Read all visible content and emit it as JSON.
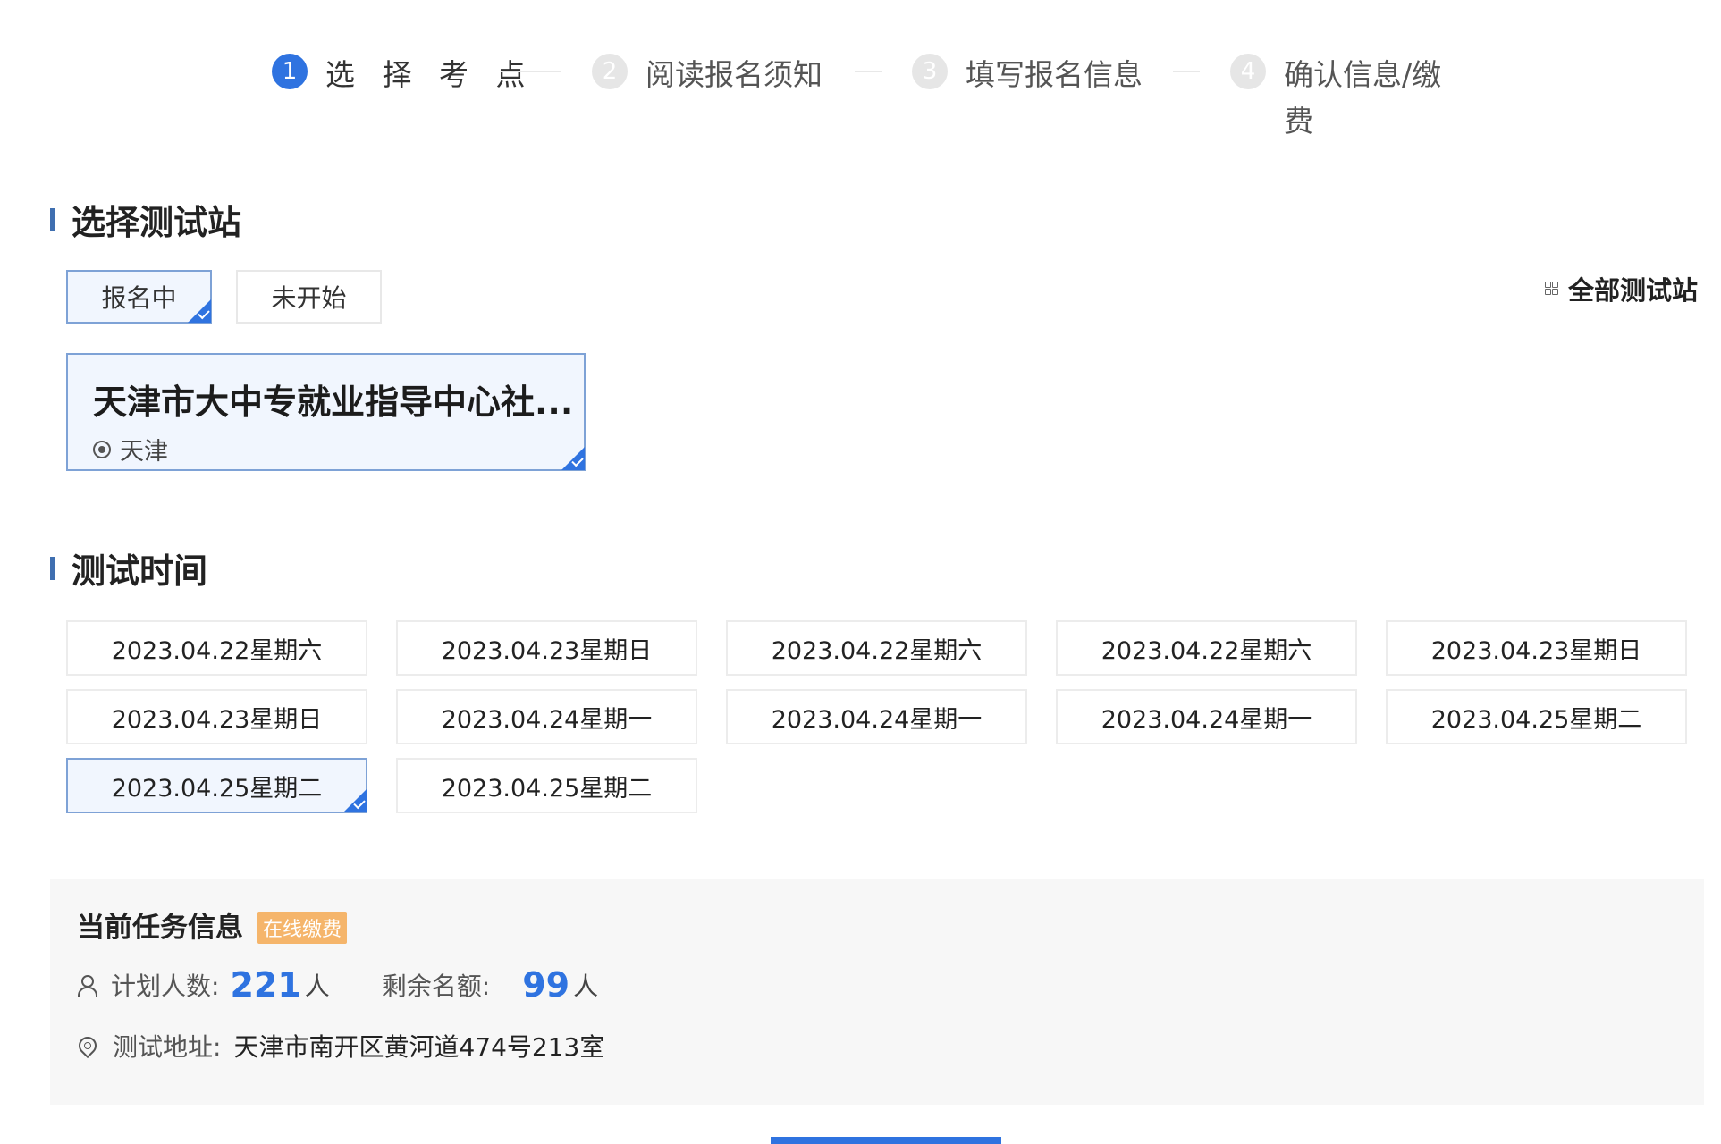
{
  "stepper": {
    "steps": [
      {
        "num": "1",
        "label": "选 择 考 点"
      },
      {
        "num": "2",
        "label": "阅读报名须知"
      },
      {
        "num": "3",
        "label": "填写报名信息"
      },
      {
        "num": "4",
        "label_line1": "确认信息/缴",
        "label_line2": "费"
      }
    ],
    "active_index": 0,
    "accent_color": "#2f73e0"
  },
  "station_section": {
    "title": "选择测试站",
    "tabs": [
      {
        "label": "报名中",
        "selected": true
      },
      {
        "label": "未开始",
        "selected": false
      }
    ],
    "all_stations_label": "全部测试站",
    "station": {
      "name": "天津市大中专就业指导中心社...",
      "location": "天津",
      "selected": true
    }
  },
  "time_section": {
    "title": "测试时间",
    "dates": [
      "2023.04.22星期六",
      "2023.04.23星期日",
      "2023.04.22星期六",
      "2023.04.22星期六",
      "2023.04.23星期日",
      "2023.04.23星期日",
      "2023.04.24星期一",
      "2023.04.24星期一",
      "2023.04.24星期一",
      "2023.04.25星期二",
      "2023.04.25星期二",
      "2023.04.25星期二"
    ],
    "selected_index": 10
  },
  "task_info": {
    "title": "当前任务信息",
    "badge": "在线缴费",
    "planned_label": "计划人数:",
    "planned_value": "221",
    "planned_unit": "人",
    "remaining_label": "剩余名额:",
    "remaining_value": "99",
    "remaining_unit": "人",
    "address_label": "测试地址:",
    "address_value": "天津市南开区黄河道474号213室"
  }
}
